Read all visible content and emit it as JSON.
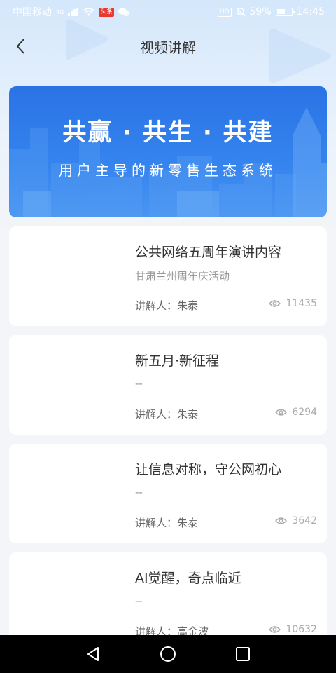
{
  "status_bar": {
    "carrier": "中国移动",
    "network": "4G",
    "app_badge": "头条",
    "hd": "HD",
    "battery": "59%",
    "battery_level": 0.59,
    "time": "14:45"
  },
  "header": {
    "title": "视频讲解",
    "back_icon": "chevron-left-icon"
  },
  "banner": {
    "title": "共赢 · 共生 · 共建",
    "subtitle": "用户主导的新零售生态系统"
  },
  "videos": [
    {
      "title": "公共网络五周年演讲内容",
      "subtitle": "甘肃兰州周年庆活动",
      "presenter": "讲解人：朱泰",
      "views": "11435"
    },
    {
      "title": "新五月·新征程",
      "subtitle": "--",
      "presenter": "讲解人：朱泰",
      "views": "6294"
    },
    {
      "title": "让信息对称，守公网初心",
      "subtitle": "--",
      "presenter": "讲解人：朱泰",
      "views": "3642"
    },
    {
      "title": "AI觉醒，奇点临近",
      "subtitle": "--",
      "presenter": "讲解人：高金波",
      "views": "10632"
    }
  ],
  "nav_bar": {
    "back_icon": "triangle-back-icon",
    "home_icon": "circle-home-icon",
    "recents_icon": "square-recents-icon"
  },
  "colors": {
    "banner": "#2a73e6",
    "background": "#f3f5f8",
    "header_gradient": "#d4e7fb"
  }
}
